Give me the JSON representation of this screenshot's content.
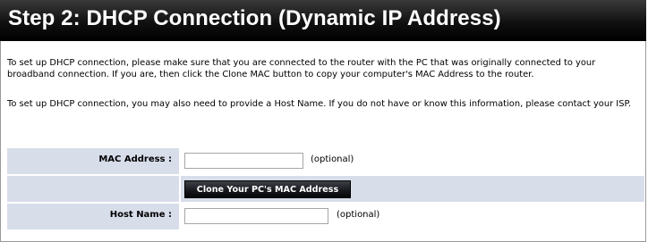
{
  "header": {
    "title": "Step 2: DHCP Connection (Dynamic IP Address)"
  },
  "instructions": {
    "paragraph1": "To set up DHCP connection, please make sure that you are connected to the router with the PC that was originally connected to your broadband connection. If you are, then click the Clone MAC button to copy your computer's MAC Address to the router.",
    "paragraph2": "To set up DHCP connection, you may also need to provide a Host Name. If you do not have or know this information, please contact your ISP."
  },
  "form": {
    "mac_address": {
      "label": "MAC Address :",
      "value": "",
      "hint": "(optional)"
    },
    "clone_button": {
      "label": "Clone Your PC's MAC Address"
    },
    "host_name": {
      "label": "Host Name :",
      "value": "",
      "hint": "(optional)"
    }
  },
  "colors": {
    "header_bg": "#000000",
    "header_text": "#ffffff",
    "label_cell_bg": "#d8ddea",
    "button_bg": "#15171c"
  }
}
